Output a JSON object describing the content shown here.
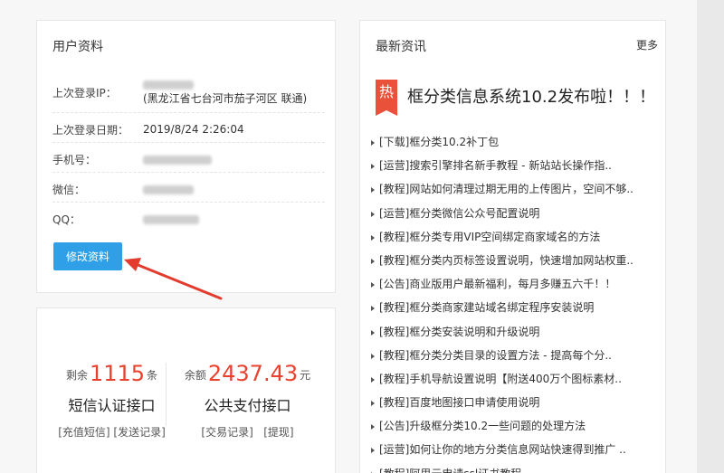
{
  "user_card": {
    "title": "用户资料",
    "rows": [
      {
        "label": "上次登录IP：",
        "value_line2": "(黑龙江省七台河市茄子河区 联通)"
      },
      {
        "label": "上次登录日期：",
        "value": "2019/8/24 2:26:04"
      },
      {
        "label": "手机号："
      },
      {
        "label": "微信："
      },
      {
        "label": "QQ："
      }
    ],
    "edit_button": "修改资料"
  },
  "stats": {
    "sms": {
      "prefix": "剩余",
      "count": "1115",
      "unit": "条",
      "name": "短信认证接口",
      "link1": "[充值短信]",
      "link2": "[发送记录]"
    },
    "pay": {
      "prefix": "余额",
      "amount": "2437.43",
      "unit": "元",
      "name": "公共支付接口",
      "link1": "[交易记录]",
      "link2": "[提现]"
    }
  },
  "news": {
    "title": "最新资讯",
    "more": "更多",
    "hot_badge": "热",
    "hot_title": "框分类信息系统10.2发布啦！！！",
    "items": [
      "[下载]框分类10.2补丁包",
      "[运营]搜索引擎排名新手教程 - 新站站长操作指..",
      "[教程]网站如何清理过期无用的上传图片，空间不够..",
      "[运营]框分类微信公众号配置说明",
      "[教程]框分类专用VIP空间绑定商家域名的方法",
      "[教程]框分类内页标签设置说明，快速增加网站权重..",
      "[公告]商业版用户最新福利，每月多赚五六千！！",
      "[教程]框分类商家建站域名绑定程序安装说明",
      "[教程]框分类安装说明和升级说明",
      "[教程]框分类分类目录的设置方法 - 提高每个分..",
      "[教程]手机导航设置说明【附送400万个图标素材..",
      "[教程]百度地图接口申请使用说明",
      "[公告]升级框分类10.2一些问题的处理方法",
      "[运营]如何让你的地方分类信息网站快速得到推广 ..",
      "[教程]阿里云申请ssl证书教程"
    ]
  },
  "colors": {
    "accent": "#2fa0e8",
    "highlight": "#e8422f",
    "hot": "#e9513b"
  }
}
